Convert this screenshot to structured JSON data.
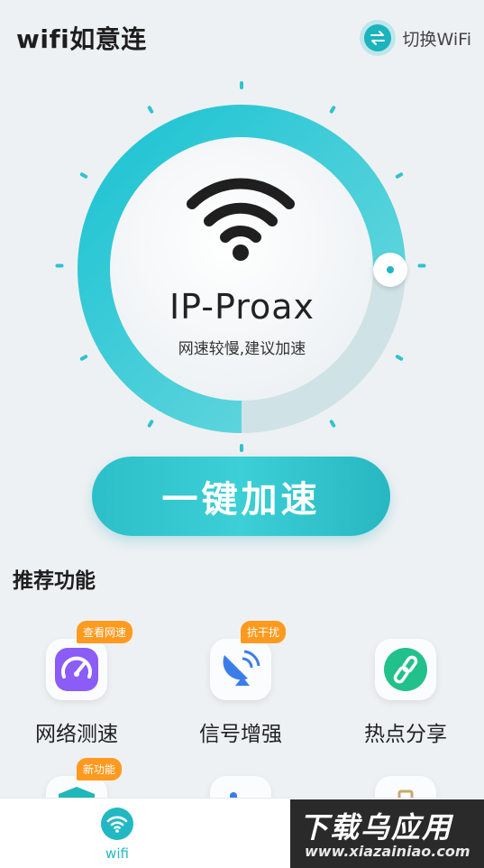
{
  "header": {
    "app_title": "wifi如意连",
    "switch_label": "切换WiFi",
    "switch_icon": "swap-arrows-icon"
  },
  "gauge": {
    "network_name": "IP-Proax",
    "status_text": "网速较慢,建议加速",
    "accent": "#22b8c3"
  },
  "boost": {
    "label": "一键加速"
  },
  "features": {
    "section_title": "推荐功能",
    "items": [
      {
        "label": "网络测速",
        "badge": "查看网速",
        "icon": "speedometer-icon"
      },
      {
        "label": "信号增强",
        "badge": "抗干扰",
        "icon": "satellite-dish-icon"
      },
      {
        "label": "热点分享",
        "badge": "",
        "icon": "link-icon"
      },
      {
        "label": "",
        "badge": "新功能",
        "icon": "shield-icon"
      },
      {
        "label": "",
        "badge": "",
        "icon": "signal-bars-icon"
      },
      {
        "label": "",
        "badge": "",
        "icon": "briefcase-icon"
      }
    ]
  },
  "bottom_nav": {
    "items": [
      {
        "label": "wifi",
        "icon": "wifi-icon",
        "active": true
      }
    ]
  },
  "watermark": {
    "title": "下载乌应用",
    "url": "www.xiazainiao.com"
  }
}
